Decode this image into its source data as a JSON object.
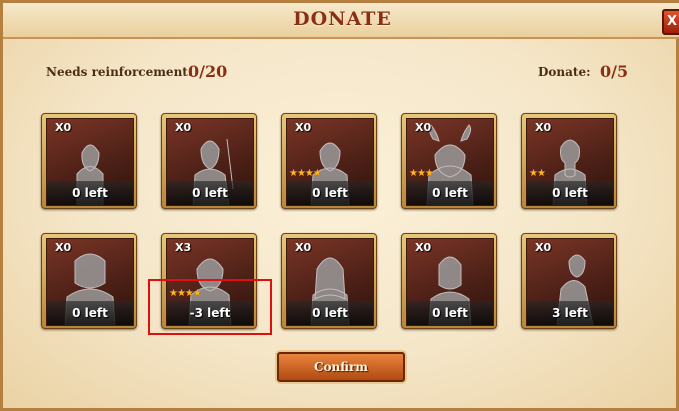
{
  "dialog": {
    "title": "DONATE",
    "close_label": "X"
  },
  "needs": {
    "label": "Needs reinforcement:",
    "value": "0/20"
  },
  "donate": {
    "label": "Donate:",
    "value": "0/5"
  },
  "cards": [
    {
      "qty": "X0",
      "stars": "",
      "left": "0 left",
      "figure": "warrior-man"
    },
    {
      "qty": "X0",
      "stars": "",
      "left": "0 left",
      "figure": "archer-woman"
    },
    {
      "qty": "X0",
      "stars": "★★★★",
      "left": "0 left",
      "figure": "rogue-man"
    },
    {
      "qty": "X0",
      "stars": "★★★",
      "left": "0 left",
      "figure": "horned-beast"
    },
    {
      "qty": "X0",
      "stars": "★★",
      "left": "0 left",
      "figure": "bearded-dwarf"
    },
    {
      "qty": "X0",
      "stars": "",
      "left": "0 left",
      "figure": "helmeted-knight"
    },
    {
      "qty": "X3",
      "stars": "★★★★",
      "left": "-3 left",
      "figure": "hooded-warrior"
    },
    {
      "qty": "X0",
      "stars": "",
      "left": "0 left",
      "figure": "blonde-woman"
    },
    {
      "qty": "X0",
      "stars": "",
      "left": "0 left",
      "figure": "silver-armor"
    },
    {
      "qty": "X0",
      "stars": "",
      "left": "3 left",
      "figure": "crouching-fighter"
    }
  ],
  "confirm_label": "Confirm",
  "colors": {
    "accent": "#8a2f12",
    "frame": "#b5803f",
    "button": "#c85a1c",
    "highlight": "#e01010"
  }
}
